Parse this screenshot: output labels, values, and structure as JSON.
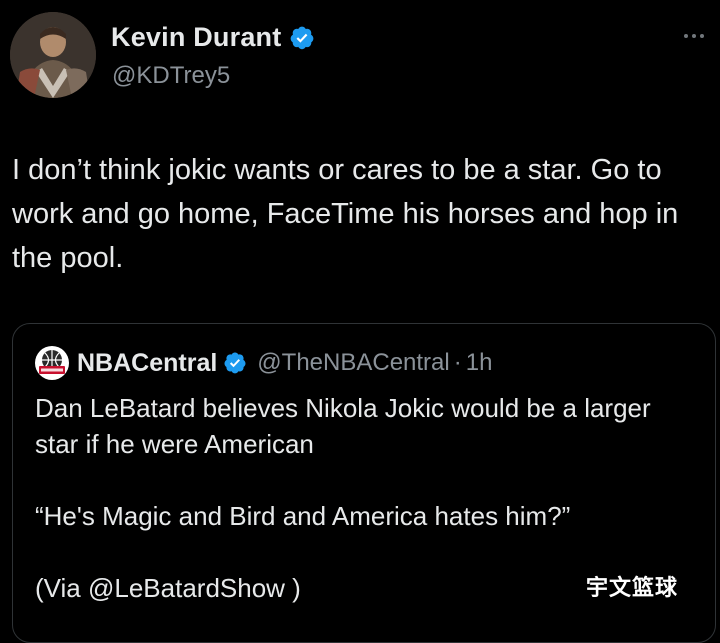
{
  "tweet": {
    "author": {
      "name": "Kevin Durant",
      "handle": "@KDTrey5",
      "verified": true
    },
    "text": "I don’t think jokic wants or cares to be a star. Go to work and go home, FaceTime his horses and hop in the pool.",
    "quoted": {
      "name": "NBACentral",
      "handle": "@TheNBACentral",
      "separator": "·",
      "time": "1h",
      "verified": true,
      "lines": [
        "Dan LeBatard believes Nikola Jokic would be a larger star if he were American",
        "“He's Magic and Bird and America hates him?”",
        "(Via @LeBatardShow )"
      ]
    }
  },
  "watermark": "宇文篮球",
  "colors": {
    "background": "#000000",
    "text": "#e7e9ea",
    "secondary_text": "#8b9299",
    "verified_blue": "#1d9bf0",
    "border": "#2f3336"
  },
  "icons": {
    "verified": "verified-badge-icon",
    "more": "more-dots-icon"
  }
}
